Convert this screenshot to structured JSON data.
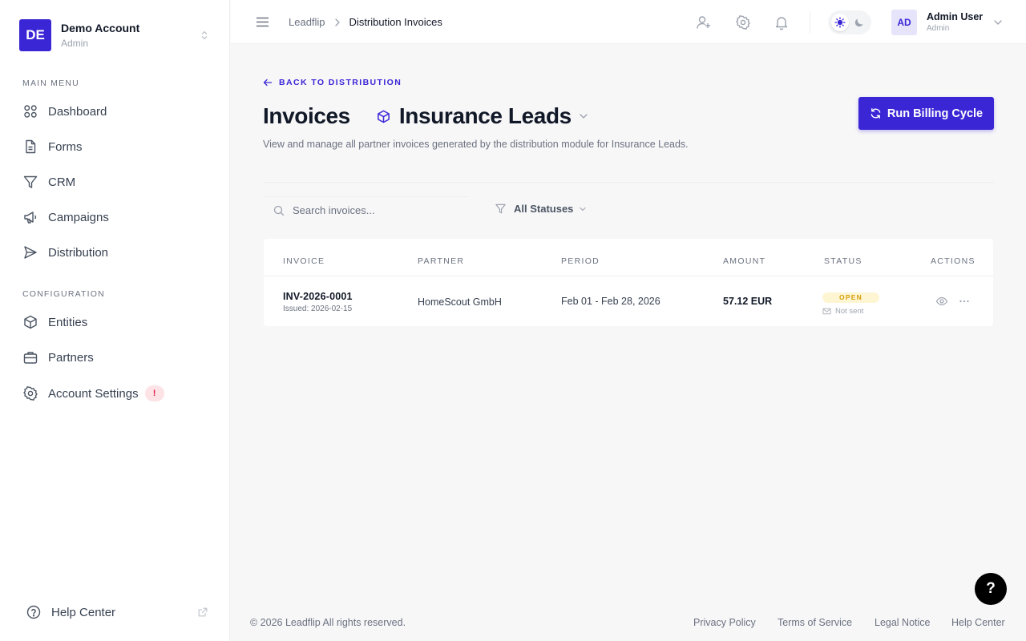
{
  "account": {
    "initials": "DE",
    "name": "Demo Account",
    "role": "Admin"
  },
  "sidebar": {
    "main_label": "MAIN MENU",
    "config_label": "CONFIGURATION",
    "main_items": [
      {
        "label": "Dashboard",
        "icon": "grid-icon"
      },
      {
        "label": "Forms",
        "icon": "document-icon"
      },
      {
        "label": "CRM",
        "icon": "funnel-icon"
      },
      {
        "label": "Campaigns",
        "icon": "megaphone-icon"
      },
      {
        "label": "Distribution",
        "icon": "send-icon"
      }
    ],
    "config_items": [
      {
        "label": "Entities",
        "icon": "cube-icon"
      },
      {
        "label": "Partners",
        "icon": "briefcase-icon"
      },
      {
        "label": "Account Settings",
        "icon": "gear-icon",
        "badge": "!"
      }
    ],
    "help_label": "Help Center"
  },
  "topbar": {
    "breadcrumb": [
      "Leadflip",
      "Distribution Invoices"
    ],
    "user": {
      "initials": "AD",
      "name": "Admin User",
      "role": "Admin"
    },
    "theme": "light"
  },
  "page": {
    "back_label": "BACK TO DISTRIBUTION",
    "title": "Invoices",
    "entity": "Insurance Leads",
    "description": "View and manage all partner invoices generated by the distribution module for Insurance Leads.",
    "primary_action": "Run Billing Cycle",
    "search_placeholder": "Search invoices...",
    "status_filter": "All Statuses"
  },
  "table": {
    "columns": [
      "INVOICE",
      "PARTNER",
      "PERIOD",
      "AMOUNT",
      "STATUS",
      "ACTIONS"
    ],
    "rows": [
      {
        "invoice": "INV-2026-0001",
        "issued": "Issued: 2026-02-15",
        "partner": "HomeScout GmbH",
        "period": "Feb 01 - Feb 28, 2026",
        "amount": "57.12 EUR",
        "status": "OPEN",
        "sent_status": "Not sent"
      }
    ]
  },
  "footer": {
    "copyright": "© 2026 Leadflip All rights reserved.",
    "links": [
      "Privacy Policy",
      "Terms of Service",
      "Legal Notice",
      "Help Center"
    ]
  },
  "help_fab": "?",
  "colors": {
    "accent": "#3b26d6",
    "status_open_bg": "#fef5d2",
    "status_open_text": "#d69e0a",
    "danger": "#e11d48"
  }
}
